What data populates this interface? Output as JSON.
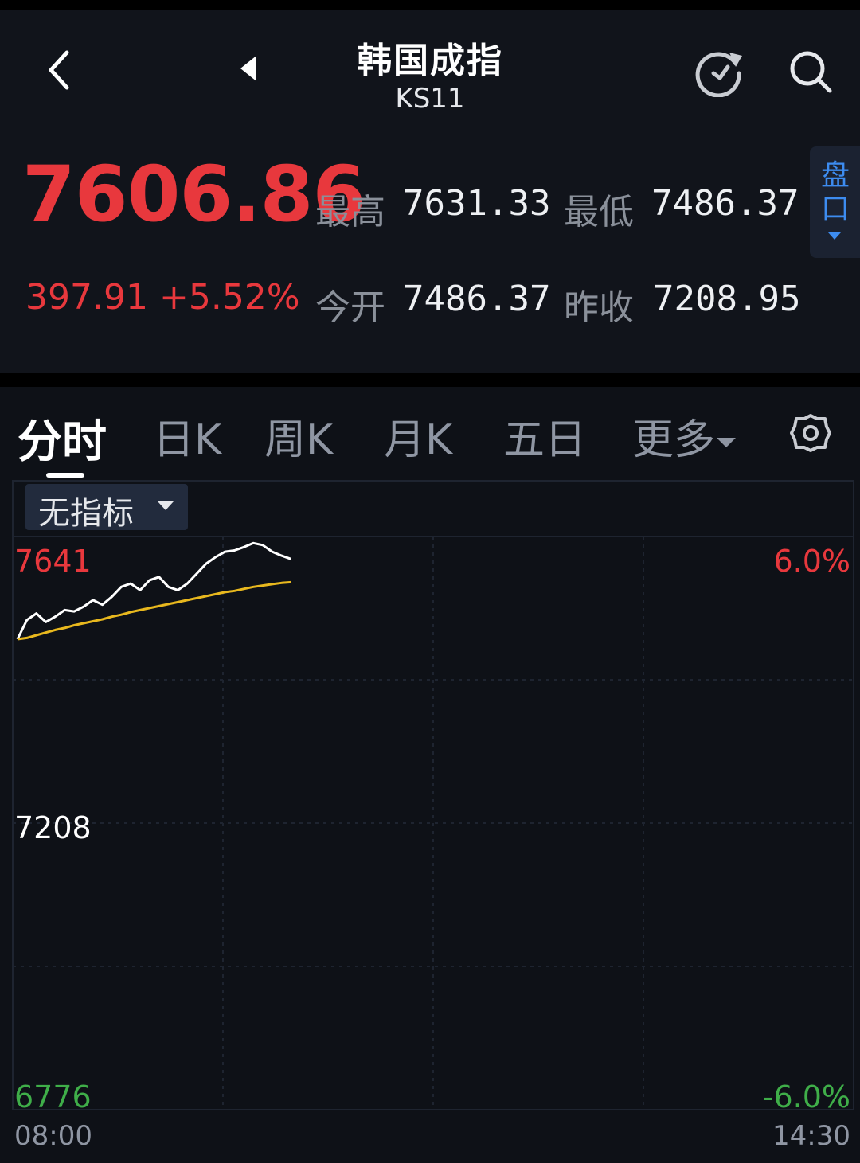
{
  "header": {
    "title": "韩国成指",
    "code": "KS11"
  },
  "quote": {
    "price": "7606.86",
    "high_label": "最高",
    "high": "7631.33",
    "low_label": "最低",
    "low": "7486.37",
    "change": "397.91",
    "change_pct": "+5.52%",
    "open_label": "今开",
    "open": "7486.37",
    "prev_close_label": "昨收",
    "prev_close": "7208.95",
    "side_panel_label": "盘口"
  },
  "tabs": [
    {
      "label": "分时"
    },
    {
      "label": "日K"
    },
    {
      "label": "周K"
    },
    {
      "label": "月K"
    },
    {
      "label": "五日"
    },
    {
      "label": "更多"
    }
  ],
  "indicator": {
    "label": "无指标"
  },
  "colors": {
    "up": "#e8383d",
    "down": "#3fae49",
    "accent": "#3d8cf0",
    "avg_line": "#e8b81e",
    "price_line": "#ffffff"
  },
  "icons": {
    "back": "chevron-left-icon",
    "prev": "triangle-left-icon",
    "refresh": "refresh-icon",
    "search": "search-icon",
    "settings": "gear-icon"
  },
  "chart_data": {
    "type": "line",
    "y_labels": {
      "top": "7641",
      "mid": "7208",
      "bottom": "6776"
    },
    "pct_labels": {
      "top": "6.0%",
      "bottom": "-6.0%"
    },
    "x_labels": {
      "start": "08:00",
      "end": "14:30"
    },
    "ylim": [
      6776,
      7641
    ],
    "reference": 7208.95,
    "grid": true,
    "session_points": 390,
    "series": [
      {
        "values": [
          7486,
          7515,
          7525,
          7512,
          7520,
          7530,
          7528,
          7535,
          7545,
          7538,
          7550,
          7565,
          7570,
          7560,
          7575,
          7580,
          7565,
          7560,
          7570,
          7585,
          7600,
          7610,
          7618,
          7620,
          7625,
          7631,
          7628,
          7618,
          7612,
          7607
        ]
      },
      {
        "values": [
          7486,
          7488,
          7492,
          7496,
          7500,
          7503,
          7507,
          7510,
          7513,
          7516,
          7520,
          7523,
          7527,
          7530,
          7533,
          7536,
          7539,
          7542,
          7545,
          7548,
          7551,
          7554,
          7557,
          7559,
          7562,
          7565,
          7567,
          7569,
          7571,
          7572
        ]
      }
    ]
  }
}
